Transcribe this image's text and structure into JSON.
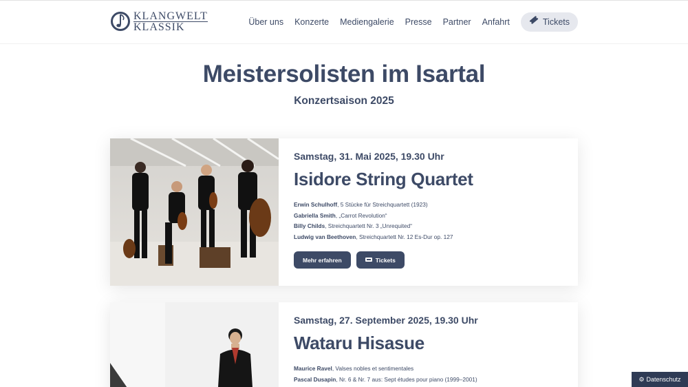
{
  "logo": {
    "line1": "KLANGWELT",
    "line2": "KLASSIK"
  },
  "nav": {
    "items": [
      "Über uns",
      "Konzerte",
      "Mediengalerie",
      "Presse",
      "Partner",
      "Anfahrt"
    ],
    "tickets_label": "Tickets"
  },
  "hero": {
    "title": "Meistersolisten im Isartal",
    "subtitle": "Konzertsaison 2025"
  },
  "concerts": [
    {
      "date": "Samstag, 31. Mai 2025, 19.30 Uhr",
      "title": "Isidore String Quartet",
      "program": [
        {
          "composer": "Erwin Schulhoff",
          "work": ", 5 Stücke für Streichquartett (1923)"
        },
        {
          "composer": "Gabriella Smith",
          "work": ", „Carrot Revolution“"
        },
        {
          "composer": "Billy Childs",
          "work": ", Streichquartett Nr. 3 „Unrequited“"
        },
        {
          "composer": "Ludwig van Beethoven",
          "work": ", Streichquartett Nr. 12 Es-Dur op. 127"
        }
      ],
      "more_label": "Mehr erfahren",
      "tickets_label": "Tickets"
    },
    {
      "date": "Samstag, 27. September 2025, 19.30 Uhr",
      "title": "Wataru Hisasue",
      "program": [
        {
          "composer": "Maurice Ravel",
          "work": ", Valses nobles et sentimentales"
        },
        {
          "composer": "Pascal Dusapin",
          "work": ", Nr. 6 & Nr. 7 aus: Sept études pour piano (1999–2001)"
        }
      ]
    }
  ],
  "privacy_label": "Datenschutz",
  "colors": {
    "primary": "#3d4a66",
    "privacy_bg": "#2f3b55",
    "nav_pill": "#e6e8ee"
  }
}
